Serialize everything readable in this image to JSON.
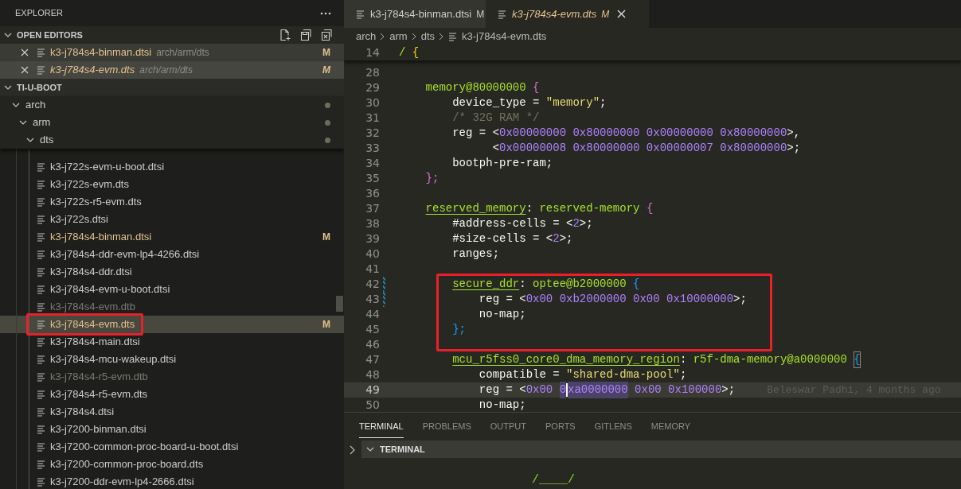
{
  "sidebar": {
    "title": "EXPLORER",
    "open_editors": {
      "title": "OPEN EDITORS",
      "expanded": true,
      "items": [
        {
          "name": "k3-j784s4-binman.dtsi",
          "path": "arch/arm/dts",
          "badge": "M",
          "selected": false
        },
        {
          "name": "k3-j784s4-evm.dts",
          "path": "arch/arm/dts",
          "badge": "M",
          "selected": true
        }
      ]
    },
    "workspace": {
      "title": "TI-U-BOOT",
      "expanded": true,
      "tree": [
        {
          "name": "arch",
          "kind": "folder",
          "expanded": true,
          "children": [
            {
              "name": "arm",
              "kind": "folder",
              "expanded": true,
              "children": [
                {
                  "name": "dts",
                  "kind": "folder",
                  "expanded": true,
                  "children": [
                    {
                      "name": "k3-j722s-evm-u-boot.dtsi",
                      "kind": "file",
                      "ignored": false,
                      "selected": false
                    },
                    {
                      "name": "k3-j722s-evm.dts",
                      "kind": "file",
                      "ignored": false,
                      "selected": false
                    },
                    {
                      "name": "k3-j722s-r5-evm.dts",
                      "kind": "file",
                      "ignored": false,
                      "selected": false
                    },
                    {
                      "name": "k3-j722s.dtsi",
                      "kind": "file",
                      "ignored": false,
                      "selected": false
                    },
                    {
                      "name": "k3-j784s4-binman.dtsi",
                      "kind": "file",
                      "badge": "M",
                      "ignored": false,
                      "selected": false
                    },
                    {
                      "name": "k3-j784s4-ddr-evm-lp4-4266.dtsi",
                      "kind": "file",
                      "ignored": false,
                      "selected": false
                    },
                    {
                      "name": "k3-j784s4-ddr.dtsi",
                      "kind": "file",
                      "ignored": false,
                      "selected": false
                    },
                    {
                      "name": "k3-j784s4-evm-u-boot.dtsi",
                      "kind": "file",
                      "ignored": false,
                      "selected": false
                    },
                    {
                      "name": "k3-j784s4-evm.dtb",
                      "kind": "file",
                      "ignored": true,
                      "selected": false
                    },
                    {
                      "name": "k3-j784s4-evm.dts",
                      "kind": "file",
                      "badge": "M",
                      "ignored": false,
                      "selected": true,
                      "boxed": true
                    },
                    {
                      "name": "k3-j784s4-main.dtsi",
                      "kind": "file",
                      "ignored": false,
                      "selected": false
                    },
                    {
                      "name": "k3-j784s4-mcu-wakeup.dtsi",
                      "kind": "file",
                      "ignored": false,
                      "selected": false
                    },
                    {
                      "name": "k3-j784s4-r5-evm.dtb",
                      "kind": "file",
                      "ignored": true,
                      "selected": false
                    },
                    {
                      "name": "k3-j784s4-r5-evm.dts",
                      "kind": "file",
                      "ignored": false,
                      "selected": false
                    },
                    {
                      "name": "k3-j784s4.dtsi",
                      "kind": "file",
                      "ignored": false,
                      "selected": false
                    },
                    {
                      "name": "k3-j7200-binman.dtsi",
                      "kind": "file",
                      "ignored": false,
                      "selected": false
                    },
                    {
                      "name": "k3-j7200-common-proc-board-u-boot.dtsi",
                      "kind": "file",
                      "ignored": false,
                      "selected": false
                    },
                    {
                      "name": "k3-j7200-common-proc-board.dts",
                      "kind": "file",
                      "ignored": false,
                      "selected": false
                    },
                    {
                      "name": "k3-j7200-ddr-evm-lp4-2666.dtsi",
                      "kind": "file",
                      "ignored": false,
                      "selected": false
                    }
                  ]
                }
              ]
            }
          ]
        }
      ]
    }
  },
  "tabs": [
    {
      "label": "k3-j784s4-binman.dtsi",
      "badge": "M",
      "selected": false
    },
    {
      "label": "k3-j784s4-evm.dts",
      "badge": "M",
      "selected": true
    }
  ],
  "breadcrumb": [
    "arch",
    "arm",
    "dts",
    "k3-j784s4-evm.dts"
  ],
  "code": [
    {
      "n": "14",
      "sticky": true,
      "tokens": [
        {
          "kind": "node",
          "t": "/"
        },
        {
          "kind": "brace3",
          "t": " {"
        }
      ]
    },
    {
      "n": "28"
    },
    {
      "n": "29",
      "tokens": [
        {
          "kind": "node",
          "t": "    memory@80000000"
        },
        {
          "kind": "brace1",
          "t": " {"
        }
      ]
    },
    {
      "n": "30",
      "tokens": [
        {
          "kind": "plain",
          "t": "        device_type = "
        },
        {
          "kind": "string",
          "t": "\"memory\""
        },
        {
          "kind": "plain",
          "t": ";"
        }
      ]
    },
    {
      "n": "31",
      "tokens": [
        {
          "kind": "comment",
          "t": "        /* 32G RAM */"
        }
      ]
    },
    {
      "n": "32",
      "tokens": [
        {
          "kind": "plain",
          "t": "        reg = <"
        },
        {
          "kind": "number",
          "t": "0x00000000 0x80000000 0x00000000 0x80000000"
        },
        {
          "kind": "plain",
          "t": ">,"
        }
      ]
    },
    {
      "n": "33",
      "tokens": [
        {
          "kind": "plain",
          "t": "              <"
        },
        {
          "kind": "number",
          "t": "0x00000008 0x80000000 0x00000007 0x80000000"
        },
        {
          "kind": "plain",
          "t": ">;"
        }
      ]
    },
    {
      "n": "34",
      "tokens": [
        {
          "kind": "plain",
          "t": "        bootph-pre-ram;"
        }
      ]
    },
    {
      "n": "35",
      "tokens": [
        {
          "kind": "brace1",
          "t": "    };"
        }
      ]
    },
    {
      "n": "36"
    },
    {
      "n": "37",
      "tokens": [
        {
          "kind": "label",
          "t": "    reserved_memory"
        },
        {
          "kind": "plain",
          "t": ": "
        },
        {
          "kind": "node",
          "t": "reserved-memory"
        },
        {
          "kind": "brace1",
          "t": " {"
        }
      ]
    },
    {
      "n": "38",
      "tokens": [
        {
          "kind": "plain",
          "t": "        #address-cells = <"
        },
        {
          "kind": "number",
          "t": "2"
        },
        {
          "kind": "plain",
          "t": ">;"
        }
      ]
    },
    {
      "n": "39",
      "tokens": [
        {
          "kind": "plain",
          "t": "        #size-cells = <"
        },
        {
          "kind": "number",
          "t": "2"
        },
        {
          "kind": "plain",
          "t": ">;"
        }
      ]
    },
    {
      "n": "40",
      "tokens": [
        {
          "kind": "plain",
          "t": "        ranges;"
        }
      ]
    },
    {
      "n": "41"
    },
    {
      "n": "42",
      "boxed": true,
      "modified": true,
      "tokens": [
        {
          "kind": "label",
          "t": "        secure_ddr"
        },
        {
          "kind": "plain",
          "t": ": "
        },
        {
          "kind": "node",
          "t": "optee@b2000000"
        },
        {
          "kind": "brace2",
          "t": " {"
        }
      ]
    },
    {
      "n": "43",
      "boxed": true,
      "modified": true,
      "tokens": [
        {
          "kind": "plain",
          "t": "            reg = <"
        },
        {
          "kind": "number",
          "t": "0x00 0xb2000000 0x00 0x10000000"
        },
        {
          "kind": "plain",
          "t": ">;"
        }
      ]
    },
    {
      "n": "44",
      "boxed": true,
      "tokens": [
        {
          "kind": "plain",
          "t": "            no-map;"
        }
      ]
    },
    {
      "n": "45",
      "boxed": true,
      "tokens": [
        {
          "kind": "brace2",
          "t": "        };"
        }
      ]
    },
    {
      "n": "46"
    },
    {
      "n": "47",
      "tokens": [
        {
          "kind": "label",
          "t": "        mcu_r5fss0_core0_dma_memory_region"
        },
        {
          "kind": "plain",
          "t": ": "
        },
        {
          "kind": "node",
          "t": "r5f-dma-memory@a0000000"
        },
        {
          "kind": "brace2-matched",
          "t": " {"
        }
      ]
    },
    {
      "n": "48",
      "tokens": [
        {
          "kind": "plain",
          "t": "            compatible = "
        },
        {
          "kind": "string",
          "t": "\"shared-dma-pool\""
        },
        {
          "kind": "plain",
          "t": ";"
        }
      ]
    },
    {
      "n": "49",
      "current": true,
      "blame": "Beleswar Padhi, 4 months ago",
      "tokens": [
        {
          "kind": "plain",
          "t": "            reg = <"
        },
        {
          "kind": "number",
          "t": "0x00 "
        },
        {
          "kind": "selected",
          "t": "0"
        },
        {
          "kind": "selected",
          "t": "xa0000000",
          "caret": true
        },
        {
          "kind": "number",
          "t": " 0x00 0x100000"
        },
        {
          "kind": "plain",
          "t": ">;"
        }
      ]
    },
    {
      "n": "50",
      "tokens": [
        {
          "kind": "plain",
          "t": "            no-map;"
        }
      ]
    }
  ],
  "panel": {
    "tabs": [
      {
        "label": "TERMINAL",
        "selected": true
      },
      {
        "label": "PROBLEMS",
        "selected": false
      },
      {
        "label": "OUTPUT",
        "selected": false
      },
      {
        "label": "PORTS",
        "selected": false
      },
      {
        "label": "GITLENS",
        "selected": false
      },
      {
        "label": "MEMORY",
        "selected": false
      }
    ],
    "section": {
      "title": "TERMINAL",
      "expanded": true
    },
    "output": [
      "/____/"
    ]
  }
}
